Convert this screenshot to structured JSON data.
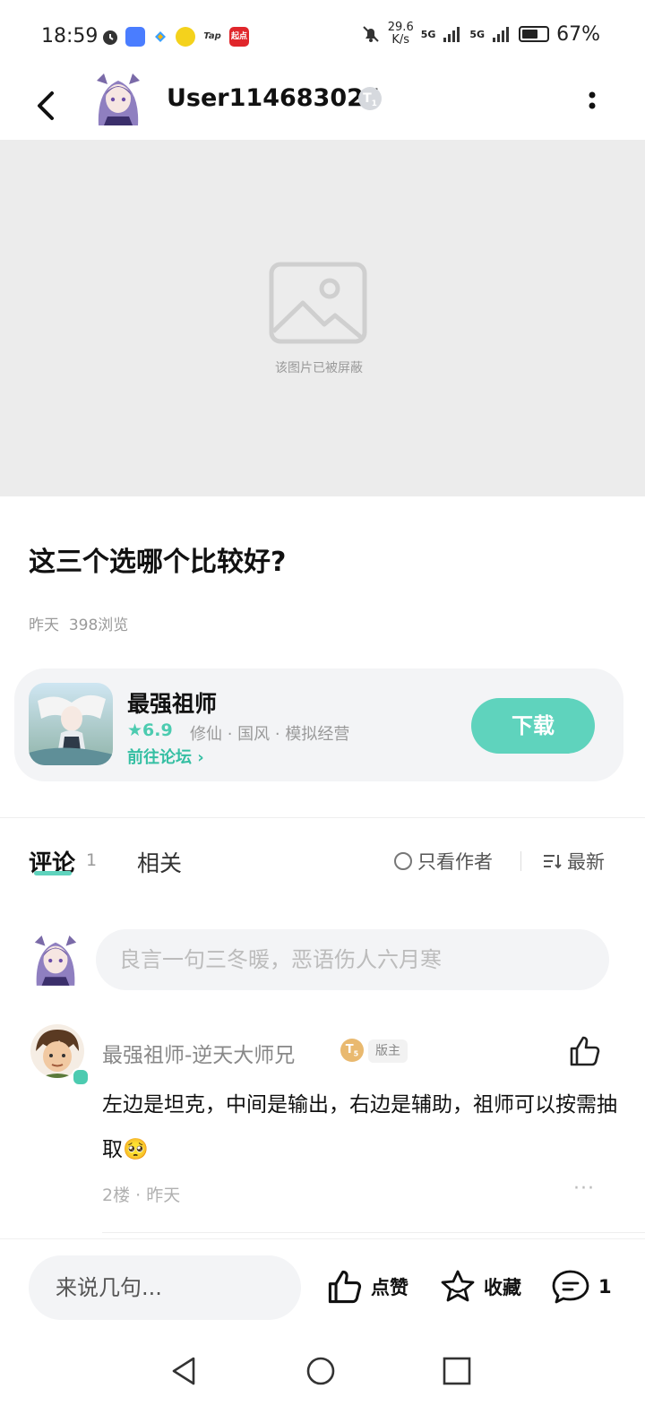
{
  "status_bar": {
    "time": "18:59",
    "net_speed_value": "29.6",
    "net_speed_unit": "K/s",
    "signal_1": "5G",
    "signal_2": "5G",
    "battery": "67%",
    "battery_level": 0.67,
    "app_icons": [
      "alarm-icon",
      "app-store-icon",
      "video-icon",
      "game-icon",
      "Tap",
      "起点"
    ]
  },
  "header": {
    "username": "User114683025",
    "level": "T",
    "level_num": "1"
  },
  "media": {
    "blocked_text": "该图片已被屏蔽"
  },
  "post": {
    "title": "这三个选哪个比较好?",
    "date": "昨天",
    "views": "398浏览"
  },
  "game_card": {
    "name": "最强祖师",
    "rating": "6.9",
    "tags": "修仙 · 国风 · 模拟经营",
    "forum_link": "前往论坛",
    "download_label": "下载"
  },
  "tabs": {
    "comments_label": "评论",
    "comments_count": "1",
    "related_label": "相关",
    "only_author_label": "只看作者",
    "sort_label": "最新"
  },
  "comment_input": {
    "placeholder": "良言一句三冬暖，恶语伤人六月寒"
  },
  "comments": [
    {
      "author": "最强祖师-逆天大师兄",
      "level": "T",
      "level_num": "5",
      "badge": "版主",
      "text": "左边是坦克，中间是输出，右边是辅助，祖师可以按需抽取",
      "emoji": "🥺",
      "floor": "2楼",
      "time": "昨天",
      "more": "···"
    }
  ],
  "bottom_bar": {
    "input_placeholder": "来说几句...",
    "like_label": "点赞",
    "fav_label": "收藏",
    "comment_count": "1"
  },
  "colors": {
    "accent": "#5fd3bd",
    "accent_dark": "#35bfa3",
    "muted": "#9a9a9a",
    "card_bg": "#f3f4f6"
  }
}
